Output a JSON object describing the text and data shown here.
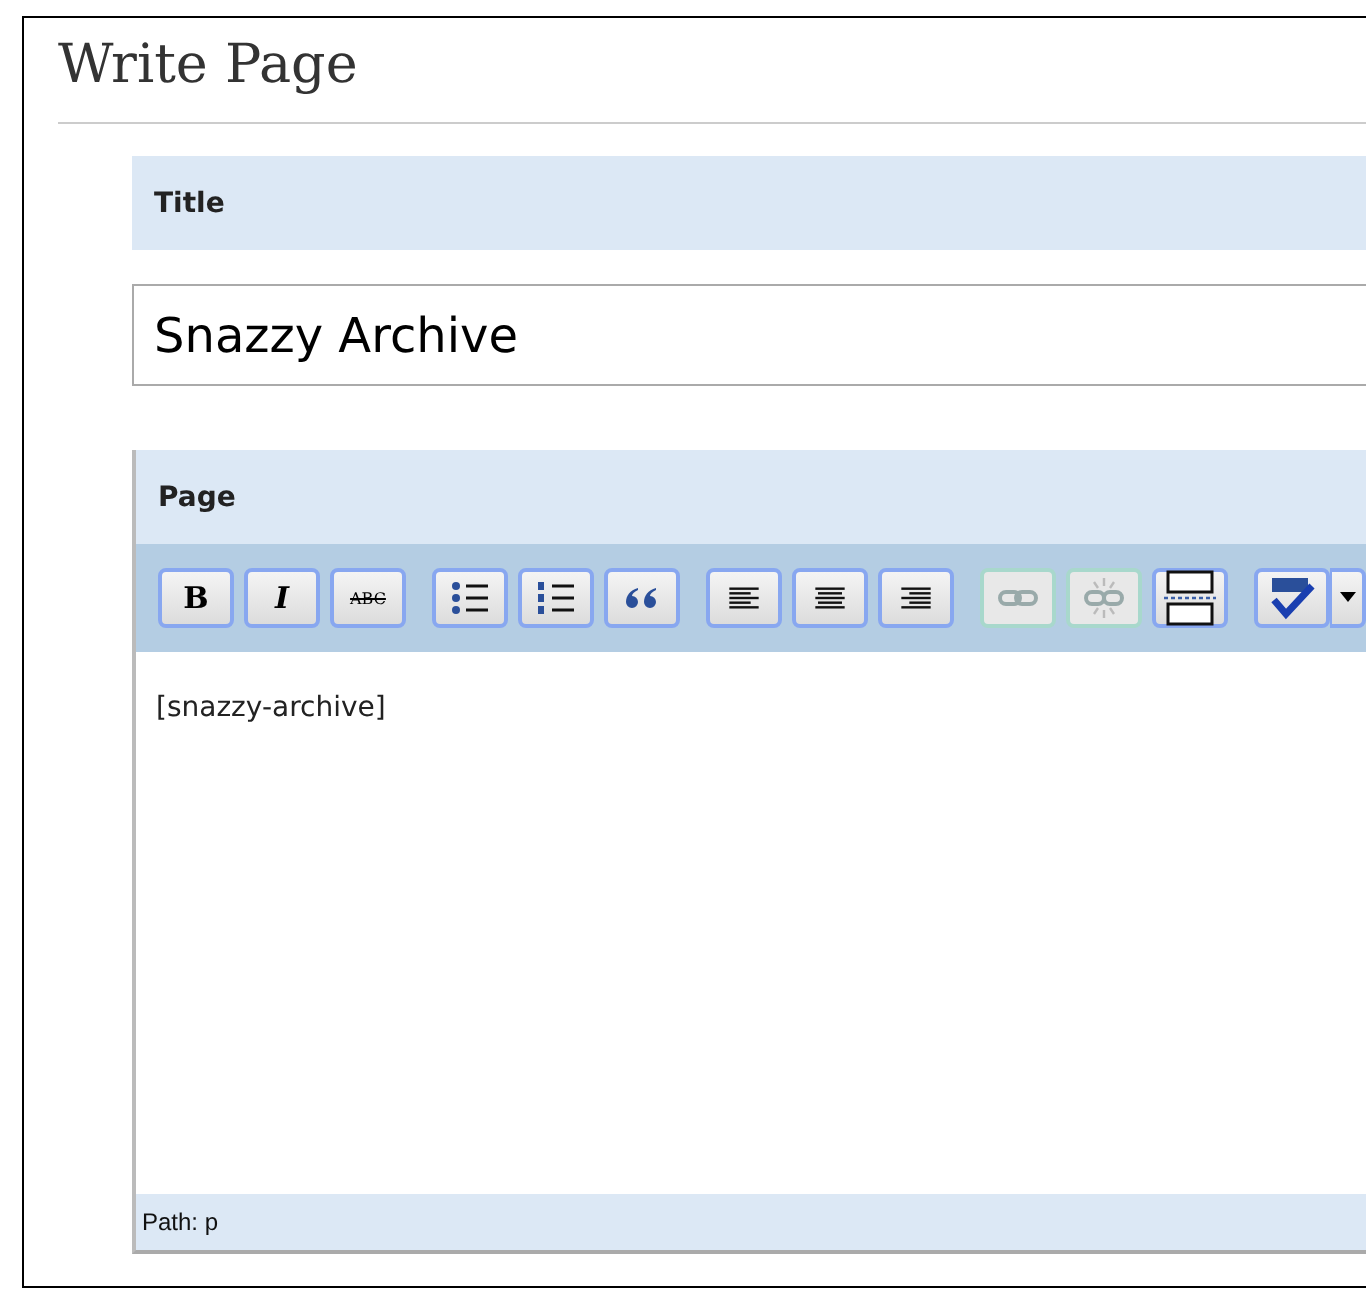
{
  "heading": "Write Page",
  "title_section": {
    "label": "Title",
    "value": "Snazzy Archive"
  },
  "page_section": {
    "label": "Page",
    "toolbar": [
      [
        {
          "kind": "bold",
          "label": "B",
          "disabled": false
        },
        {
          "kind": "italic",
          "label": "I",
          "disabled": false
        },
        {
          "kind": "strikethrough",
          "label": "ABC",
          "disabled": false
        }
      ],
      [
        {
          "kind": "bullets",
          "disabled": false
        },
        {
          "kind": "numbers",
          "disabled": false
        },
        {
          "kind": "quote",
          "disabled": false
        }
      ],
      [
        {
          "kind": "align-left",
          "disabled": false
        },
        {
          "kind": "align-center",
          "disabled": false
        },
        {
          "kind": "align-right",
          "disabled": false
        }
      ],
      [
        {
          "kind": "link",
          "disabled": true
        },
        {
          "kind": "unlink",
          "disabled": true
        },
        {
          "kind": "more",
          "disabled": false
        }
      ],
      [
        {
          "kind": "spellcheck",
          "disabled": false
        },
        {
          "kind": "dropdown",
          "disabled": false
        }
      ]
    ],
    "content": "[snazzy-archive]",
    "path": "Path: p"
  }
}
